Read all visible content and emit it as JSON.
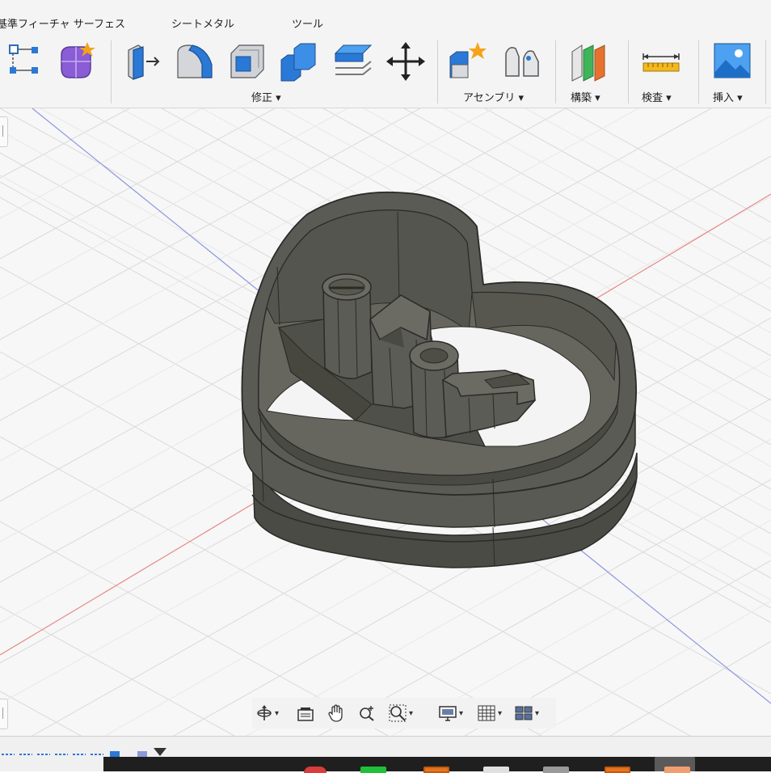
{
  "toolbar": {
    "tabs": [
      {
        "label": "基準フィーチャ サーフェス"
      },
      {
        "label": "シートメタル"
      },
      {
        "label": "ツール"
      }
    ],
    "groups": [
      {
        "label": "修正 ▾"
      },
      {
        "label": "アセンブリ ▾"
      },
      {
        "label": "構築 ▾"
      },
      {
        "label": "検査 ▾"
      },
      {
        "label": "挿入 ▾"
      }
    ],
    "tools": [
      {
        "icon": "sketch-dimension-icon"
      },
      {
        "icon": "form-create-icon"
      },
      {
        "icon": "press-pull-icon"
      },
      {
        "icon": "fillet-icon"
      },
      {
        "icon": "shell-icon"
      },
      {
        "icon": "combine-icon"
      },
      {
        "icon": "offset-face-icon"
      },
      {
        "icon": "move-copy-icon"
      },
      {
        "icon": "new-component-icon"
      },
      {
        "icon": "joint-icon"
      },
      {
        "icon": "construct-plane-icon"
      },
      {
        "icon": "measure-icon"
      },
      {
        "icon": "insert-image-icon"
      }
    ]
  },
  "navbar": {
    "items": [
      {
        "icon": "orbit-icon",
        "dropdown": true
      },
      {
        "icon": "look-at-icon",
        "dropdown": false
      },
      {
        "icon": "pan-hand-icon",
        "dropdown": false
      },
      {
        "icon": "zoom-icon",
        "dropdown": false
      },
      {
        "icon": "zoom-window-icon",
        "dropdown": true
      },
      {
        "icon": "display-settings-icon",
        "dropdown": true
      },
      {
        "icon": "grid-settings-icon",
        "dropdown": true
      },
      {
        "icon": "viewports-icon",
        "dropdown": true
      }
    ]
  },
  "model": {
    "description": "heart-shaped cookie cutter with embossed letters",
    "letters": [
      "e",
      "v",
      "o",
      "L"
    ]
  },
  "colors": {
    "model_fill": "#5a5a54",
    "model_dark": "#3c3c38",
    "grid_line": "#dcdcdc",
    "axis_x": "#e07070",
    "axis_z": "#7a8ae0",
    "accent_blue": "#2a79d6",
    "accent_purple": "#8a5cd6",
    "taskbar": "#1f1f1f"
  }
}
